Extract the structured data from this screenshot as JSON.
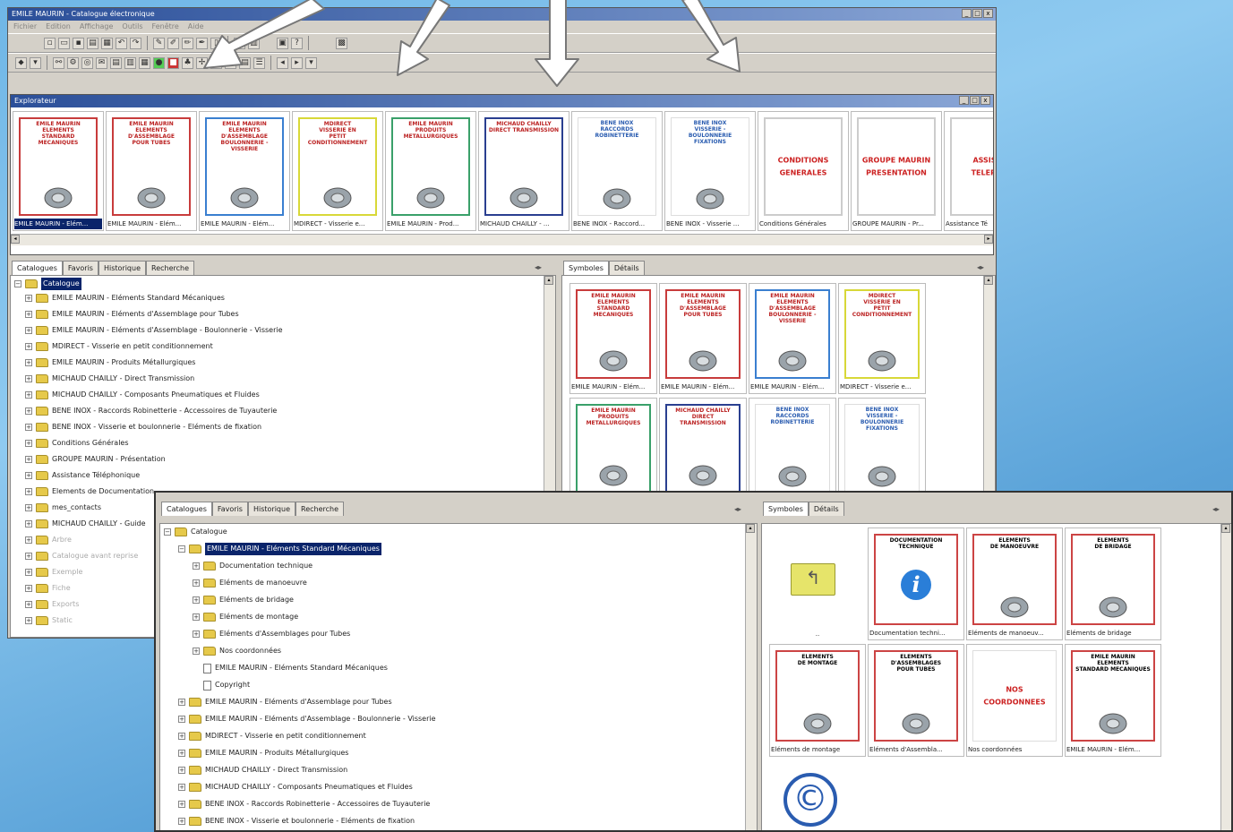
{
  "main_window": {
    "title": "EMILE MAURIN - Catalogue électronique",
    "menu": [
      "Fichier",
      "Edition",
      "Affichage",
      "Outils",
      "Fenêtre",
      "Aide"
    ],
    "window_buttons": [
      "_",
      "□",
      "x"
    ]
  },
  "sub_window": {
    "title": "Explorateur",
    "window_buttons": [
      "_",
      "□",
      "x"
    ]
  },
  "thumbnails": [
    {
      "card": "EMILE MAURIN\nELEMENTS\nSTANDARD MECANIQUES",
      "caption": "EMILE MAURIN - Elém...",
      "border": "#c83c3c",
      "selected": true
    },
    {
      "card": "EMILE MAURIN\nELEMENTS D'ASSEMBLAGE\nPOUR TUBES",
      "caption": "EMILE MAURIN - Elém...",
      "border": "#c83c3c"
    },
    {
      "card": "EMILE MAURIN\nELEMENTS D'ASSEMBLAGE\nBOULONNERIE - VISSERIE",
      "caption": "EMILE MAURIN - Elém...",
      "border": "#3a7fd0"
    },
    {
      "card": "MDIRECT\nVISSERIE EN\nPETIT CONDITIONNEMENT",
      "caption": "MDIRECT - Visserie e...",
      "border": "#d8d838"
    },
    {
      "card": "EMILE MAURIN\nPRODUITS\nMETALLURGIQUES",
      "caption": "EMILE MAURIN - Prod...",
      "border": "#3aa06a"
    },
    {
      "card": "MICHAUD CHAILLY\nDIRECT TRANSMISSION",
      "caption": "MICHAUD CHAILLY - ...",
      "border": "#2a3f90"
    },
    {
      "card": "BENE INOX\nRACCORDS\nROBINETTERIE",
      "caption": "BENE INOX - Raccord...",
      "border": "#ffffff"
    },
    {
      "card": "BENE INOX\nVISSERIE - BOULONNERIE\nFIXATIONS",
      "caption": "BENE INOX - Visserie ...",
      "border": "#ffffff"
    },
    {
      "card": "CONDITIONS\n\nGENERALES",
      "caption": "Conditions Générales",
      "border": "#cccccc",
      "text": true
    },
    {
      "card": "GROUPE MAURIN\n\nPRESENTATION",
      "caption": "GROUPE MAURIN - Pr...",
      "border": "#cccccc",
      "text": true
    },
    {
      "card": "ASSISTA\n\nTELEPHO",
      "caption": "Assistance Té",
      "border": "#cccccc",
      "text": true
    }
  ],
  "back_left": {
    "tabs": [
      "Catalogues",
      "Favoris",
      "Historique",
      "Recherche"
    ],
    "root": "Catalogue",
    "items": [
      "EMILE MAURIN - Eléments Standard Mécaniques",
      "EMILE MAURIN - Eléments d'Assemblage pour Tubes",
      "EMILE MAURIN - Eléments d'Assemblage - Boulonnerie - Visserie",
      "MDIRECT - Visserie en petit conditionnement",
      "EMILE MAURIN - Produits Métallurgiques",
      "MICHAUD CHAILLY - Direct Transmission",
      "MICHAUD CHAILLY - Composants Pneumatiques et Fluides",
      "BENE INOX - Raccords Robinetterie - Accessoires de Tuyauterie",
      "BENE INOX - Visserie et boulonnerie - Eléments de fixation",
      "Conditions Générales",
      "GROUPE MAURIN - Présentation",
      "Assistance Téléphonique",
      "Elements de Documentation",
      "mes_contacts",
      "MICHAUD CHAILLY - Guide",
      "Arbre",
      "Catalogue avant reprise",
      "Exemple",
      "Fiche",
      "Exports",
      "Static"
    ]
  },
  "back_right": {
    "tabs": [
      "Symboles",
      "Détails"
    ],
    "thumbs": [
      {
        "card": "EMILE MAURIN\nELEMENTS\nSTANDARD MECANIQUES",
        "caption": "EMILE MAURIN - Elém...",
        "border": "#c83c3c"
      },
      {
        "card": "EMILE MAURIN\nELEMENTS D'ASSEMBLAGE\nPOUR TUBES",
        "caption": "EMILE MAURIN - Elém...",
        "border": "#c83c3c"
      },
      {
        "card": "EMILE MAURIN\nELEMENTS D'ASSEMBLAGE\nBOULONNERIE - VISSERIE",
        "caption": "EMILE MAURIN - Elém...",
        "border": "#3a7fd0"
      },
      {
        "card": "MDIRECT\nVISSERIE EN\nPETIT CONDITIONNEMENT",
        "caption": "MDIRECT - Visserie e...",
        "border": "#d8d838"
      },
      {
        "card": "EMILE MAURIN\nPRODUITS\nMETALLURGIQUES",
        "caption": "",
        "border": "#3aa06a"
      },
      {
        "card": "MICHAUD CHAILLY\nDIRECT TRANSMISSION",
        "caption": "",
        "border": "#2a3f90"
      },
      {
        "card": "BENE INOX\nRACCORDS\nROBINETTERIE",
        "caption": "",
        "border": "#ffffff"
      },
      {
        "card": "BENE INOX\nVISSERIE - BOULONNERIE\nFIXATIONS",
        "caption": "",
        "border": "#ffffff"
      }
    ]
  },
  "front_left": {
    "tabs": [
      "Catalogues",
      "Favoris",
      "Historique",
      "Recherche"
    ],
    "root": "Catalogue",
    "selected": "EMILE MAURIN - Eléments Standard Mécaniques",
    "children": [
      {
        "label": "Documentation technique",
        "type": "folder"
      },
      {
        "label": "Eléments de manoeuvre",
        "type": "folder"
      },
      {
        "label": "Eléments de bridage",
        "type": "folder"
      },
      {
        "label": "Eléments de montage",
        "type": "folder"
      },
      {
        "label": "Eléments d'Assemblages pour Tubes",
        "type": "folder"
      },
      {
        "label": "Nos coordonnées",
        "type": "folder"
      },
      {
        "label": "EMILE MAURIN - Eléments Standard Mécaniques",
        "type": "doc"
      },
      {
        "label": "Copyright",
        "type": "doc"
      }
    ],
    "siblings": [
      "EMILE MAURIN - Eléments d'Assemblage pour Tubes",
      "EMILE MAURIN - Eléments d'Assemblage - Boulonnerie - Visserie",
      "MDIRECT - Visserie en petit conditionnement",
      "EMILE MAURIN - Produits Métallurgiques",
      "MICHAUD CHAILLY - Direct Transmission",
      "MICHAUD CHAILLY - Composants Pneumatiques et Fluides",
      "BENE INOX - Raccords Robinetterie - Accessoires de Tuyauterie",
      "BENE INOX - Visserie et boulonnerie - Eléments de fixation"
    ]
  },
  "front_right": {
    "tabs": [
      "Symboles",
      "Détails"
    ],
    "up_caption": "..",
    "items": [
      {
        "card": "DOCUMENTATION\nTECHNIQUE",
        "caption": "Documentation techni...",
        "icon": "info-icon"
      },
      {
        "card": "ELEMENTS\nDE MANOEUVRE",
        "caption": "Eléments de manoeuv...",
        "icon": "handle-icon"
      },
      {
        "card": "ELEMENTS\nDE BRIDAGE",
        "caption": "Eléments de bridage",
        "icon": "clamp-icon"
      },
      {
        "card": "ELEMENTS\nDE MONTAGE",
        "caption": "Eléments de montage",
        "icon": "mount-icon"
      },
      {
        "card": "ELEMENTS\nD'ASSEMBLAGES\nPOUR TUBES",
        "caption": "Eléments d'Assembla...",
        "icon": "tube-icon"
      },
      {
        "card": "NOS\n\nCOORDONNEES",
        "caption": "Nos coordonnées",
        "icon": "text"
      },
      {
        "card": "EMILE MAURIN\nELEMENTS\nSTANDARD MECANIQUES",
        "caption": "EMILE MAURIN - Elém...",
        "icon": "wheel-icon"
      }
    ],
    "copyright_symbol": "©"
  }
}
